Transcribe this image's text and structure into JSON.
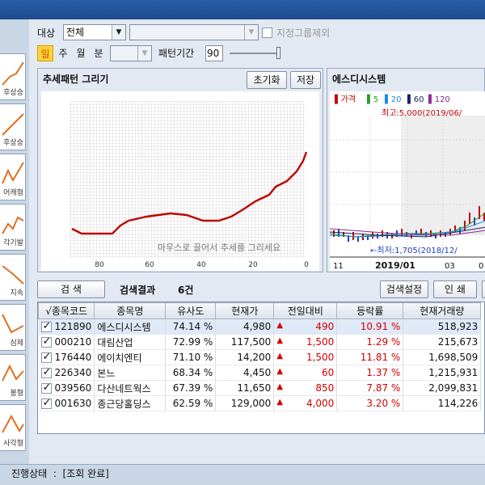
{
  "filters": {
    "target_label": "대상",
    "target_value": "전체",
    "exclude_group_label": "지정그룹제외",
    "exclude_group_checked": false,
    "periods": [
      "일",
      "주",
      "월",
      "분"
    ],
    "active_period": "일",
    "pattern_period_label": "패턴기간",
    "pattern_period_value": "90"
  },
  "pattern_panel": {
    "title": "추세패턴 그리기",
    "reset_label": "초기화",
    "save_label": "저장",
    "hint": "마우스로 끌어서 추세를 그리세요",
    "x_ticks": [
      "80",
      "60",
      "40",
      "20",
      "0"
    ]
  },
  "stock_panel": {
    "title": "에스디시스템",
    "legend": [
      {
        "label": "가격",
        "color": "#c00000"
      },
      {
        "label": "5",
        "color": "#2a9a2a"
      },
      {
        "label": "20",
        "color": "#1e88e5"
      },
      {
        "label": "60",
        "color": "#202060"
      },
      {
        "label": "120",
        "color": "#8e2a8e"
      }
    ],
    "high_label": "최고:5,000(2019/06/",
    "low_label": "←최저:1,705(2018/12/",
    "x_ticks": [
      "11",
      "2019/01",
      "03",
      "0"
    ]
  },
  "search": {
    "search_label": "검  색",
    "result_label": "검색결과",
    "result_count": "6건",
    "settings_label": "검색설정",
    "print_label": "인  쇄"
  },
  "table": {
    "headers": [
      "√종목코드",
      "종목명",
      "유사도",
      "현재가",
      "전일대비",
      "등락률",
      "현재거래량"
    ],
    "rows": [
      {
        "checked": true,
        "code": "121890",
        "name": "에스디시스템",
        "similarity": "74.14 %",
        "price": "4,980",
        "change": "490",
        "rate": "10.91 %",
        "volume": "518,923"
      },
      {
        "checked": true,
        "code": "000210",
        "name": "대림산업",
        "similarity": "72.99 %",
        "price": "117,500",
        "change": "1,500",
        "rate": "1.29 %",
        "volume": "215,673"
      },
      {
        "checked": true,
        "code": "176440",
        "name": "에이치엔티",
        "similarity": "71.10 %",
        "price": "14,200",
        "change": "1,500",
        "rate": "11.81 %",
        "volume": "1,698,509"
      },
      {
        "checked": true,
        "code": "226340",
        "name": "본느",
        "similarity": "68.34 %",
        "price": "4,450",
        "change": "60",
        "rate": "1.37 %",
        "volume": "1,215,931"
      },
      {
        "checked": true,
        "code": "039560",
        "name": "다산네트웍스",
        "similarity": "67.39 %",
        "price": "11,650",
        "change": "850",
        "rate": "7.87 %",
        "volume": "2,099,831"
      },
      {
        "checked": true,
        "code": "001630",
        "name": "종근당홀딩스",
        "similarity": "62.59 %",
        "price": "129,000",
        "change": "4,000",
        "rate": "3.20 %",
        "volume": "114,226"
      }
    ]
  },
  "sidebar": {
    "items": [
      {
        "label": "후상승",
        "icon": "rising-trend-icon"
      },
      {
        "label": "후상승",
        "icon": "rising-line-icon"
      },
      {
        "label": "어캐형",
        "icon": "shoulder-pattern-icon"
      },
      {
        "label": "각기발",
        "icon": "zigzag-rising-icon"
      },
      {
        "label": "지속",
        "icon": "falling-trend-icon"
      },
      {
        "label": "심제",
        "icon": "drop-pattern-icon"
      },
      {
        "label": "봉형",
        "icon": "peak-pattern-icon"
      },
      {
        "label": "사각형",
        "icon": "triangle-pattern-icon"
      }
    ]
  },
  "status": {
    "label": "진행상태",
    "value": "[조회 완료]"
  }
}
